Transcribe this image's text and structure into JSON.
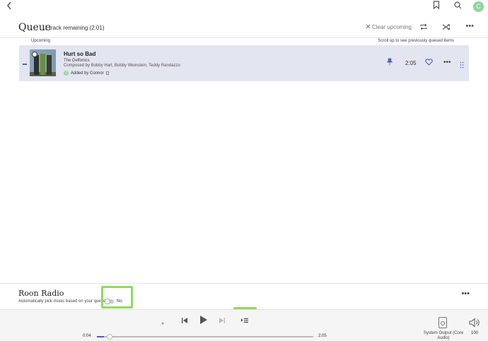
{
  "topbar": {
    "back_icon": "chevron-left-icon",
    "avatar_letter": "C"
  },
  "queue": {
    "title": "Queue",
    "subtitle": "1 track remaining (2:01)",
    "clear_upcoming": "Clear upcoming",
    "upcoming_label": "Upcoming",
    "scroll_hint": "Scroll up to see previously queued items"
  },
  "track": {
    "title": "Hurt so Bad",
    "artist": "The Delfonics",
    "composer": "Composed by Bobby Hart, Bobby Weinstein, Teddy Randazzo",
    "added_by": "Added by Connor",
    "added_avatar_letter": "C",
    "duration": "2:05"
  },
  "radio": {
    "title": "Roon Radio",
    "subtitle": "Automatically pick music based on your queue",
    "toggle_text": "No",
    "enabled": false
  },
  "player": {
    "time_elapsed": "0:04",
    "time_total": "2:05",
    "progress_fraction": 0.032,
    "zone_name": "System Output (Core Audio)",
    "volume": "100"
  },
  "colors": {
    "accent": "#5458c7",
    "highlight": "#8fdc5a",
    "row_background": "#e3e5f0",
    "avatar": "#8fd49a"
  }
}
